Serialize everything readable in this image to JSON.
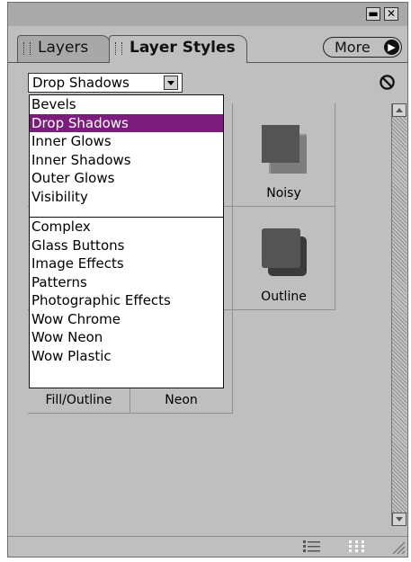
{
  "window": {
    "minimize_glyph": "▬",
    "close_glyph": "✕"
  },
  "tabs": [
    {
      "label": "Layers",
      "active": false
    },
    {
      "label": "Layer Styles",
      "active": true
    }
  ],
  "more_button": {
    "label": "More",
    "arrow_glyph": "▶"
  },
  "category_select": {
    "value": "Drop Shadows"
  },
  "dropdown": {
    "group1": [
      "Bevels",
      "Drop Shadows",
      "Inner Glows",
      "Inner Shadows",
      "Outer Glows",
      "Visibility"
    ],
    "group2": [
      "Complex",
      "Glass Buttons",
      "Image Effects",
      "Patterns",
      "Photographic Effects",
      "Wow Chrome",
      "Wow Neon",
      "Wow Plastic"
    ],
    "selected": "Drop Shadows"
  },
  "style_grid": {
    "visible_labels": {
      "noisy": "Noisy",
      "outline": "Outline",
      "fill_outline": "Fill/Outline",
      "neon": "Neon"
    }
  },
  "icons": {
    "clear_style": "no-symbol-icon",
    "list_view": "list-view-icon",
    "thumbnail_view": "thumbnail-view-icon",
    "resize": "resize-grip-icon"
  },
  "colors": {
    "panel_bg": "#bfbfbf",
    "selection": "#7b1e7b",
    "swatch": "#545454"
  }
}
